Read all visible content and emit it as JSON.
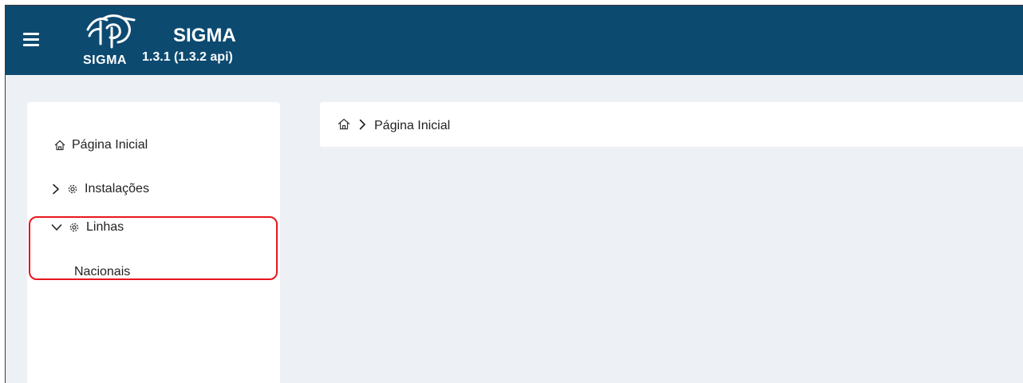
{
  "header": {
    "title": "SIGMA",
    "version": "1.3.1 (1.3.2 api)",
    "logo_word": "SIGMA",
    "background_color": "#0d4a70"
  },
  "icons": {
    "menu": "hamburger-menu-icon",
    "logo": "sigma-logo",
    "home": "home-icon",
    "gear": "gear-icon",
    "chevron_right": "chevron-right-icon",
    "chevron_down": "chevron-down-icon"
  },
  "sidebar": {
    "items": [
      {
        "label": "Página Inicial",
        "icon": "home-icon"
      },
      {
        "label": "Instalações",
        "icon": "gear-icon",
        "expanded": false
      },
      {
        "label": "Linhas",
        "icon": "gear-icon",
        "expanded": true,
        "children": [
          {
            "label": "Nacionais"
          }
        ]
      }
    ]
  },
  "breadcrumb": {
    "items": [
      "Página Inicial"
    ]
  },
  "colors": {
    "highlight": "#e8161c",
    "page_background": "#edf0f5"
  }
}
